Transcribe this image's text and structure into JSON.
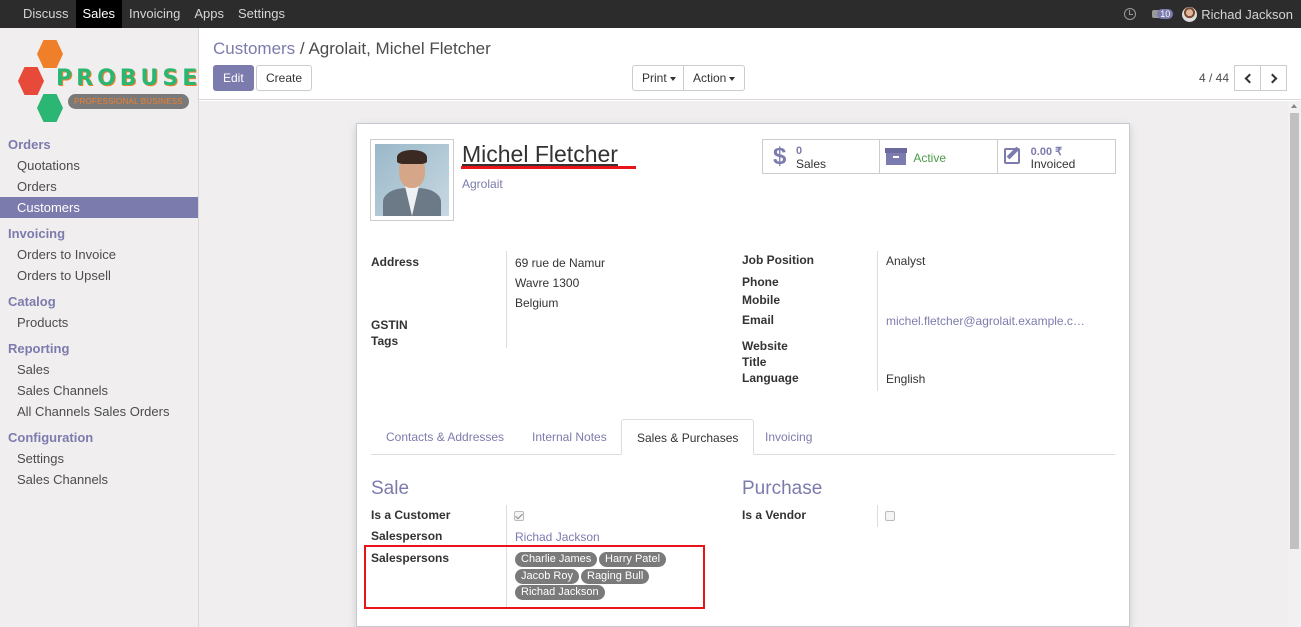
{
  "topbar": {
    "menu": [
      "Discuss",
      "Sales",
      "Invoicing",
      "Apps",
      "Settings"
    ],
    "active": "Sales",
    "messages_count": "10",
    "user": "Richad Jackson"
  },
  "logo": {
    "word": "PROBUSE",
    "tagline": "PROFESSIONAL BUSINESS"
  },
  "sidebar": {
    "orders": {
      "title": "Orders",
      "items": [
        "Quotations",
        "Orders",
        "Customers"
      ]
    },
    "invoicing": {
      "title": "Invoicing",
      "items": [
        "Orders to Invoice",
        "Orders to Upsell"
      ]
    },
    "catalog": {
      "title": "Catalog",
      "items": [
        "Products"
      ]
    },
    "reporting": {
      "title": "Reporting",
      "items": [
        "Sales",
        "Sales Channels",
        "All Channels Sales Orders"
      ]
    },
    "configuration": {
      "title": "Configuration",
      "items": [
        "Settings",
        "Sales Channels"
      ]
    },
    "active_item": "Customers"
  },
  "control": {
    "breadcrumb_parent": "Customers",
    "breadcrumb_sep": "/",
    "breadcrumb_current": "Agrolait, Michel Fletcher",
    "edit": "Edit",
    "create": "Create",
    "print": "Print",
    "action": "Action",
    "pager": "4 / 44"
  },
  "partner": {
    "name": "Michel Fletcher",
    "company": "Agrolait"
  },
  "stats": {
    "sales_value": "0",
    "sales_label": "Sales",
    "active_label": "Active",
    "invoiced_value": "0.00 ₹",
    "invoiced_label": "Invoiced"
  },
  "fields_left": {
    "address_label": "Address",
    "street": "69 rue de Namur",
    "city_zip": "Wavre 1300",
    "country": "Belgium",
    "gstin_label": "GSTIN",
    "tags_label": "Tags"
  },
  "fields_right": {
    "job_label": "Job Position",
    "job_value": "Analyst",
    "phone_label": "Phone",
    "mobile_label": "Mobile",
    "email_label": "Email",
    "email_value": "michel.fletcher@agrolait.example.c…",
    "website_label": "Website",
    "title_label": "Title",
    "language_label": "Language",
    "language_value": "English"
  },
  "tabs": [
    "Contacts & Addresses",
    "Internal Notes",
    "Sales & Purchases",
    "Invoicing"
  ],
  "active_tab": "Sales & Purchases",
  "sale": {
    "heading": "Sale",
    "is_customer_label": "Is a Customer",
    "is_customer": true,
    "salesperson_label": "Salesperson",
    "salesperson_value": "Richad Jackson",
    "salespersons_label": "Salespersons",
    "salespersons": [
      "Charlie James",
      "Harry Patel",
      "Jacob Roy",
      "Raging Bull",
      "Richad Jackson"
    ]
  },
  "purchase": {
    "heading": "Purchase",
    "is_vendor_label": "Is a Vendor",
    "is_vendor": false
  },
  "colors": {
    "accent": "#7c7bad",
    "highlight": "#e8141a",
    "topbar": "#2c2c2c",
    "tag": "#7a7a7a"
  }
}
